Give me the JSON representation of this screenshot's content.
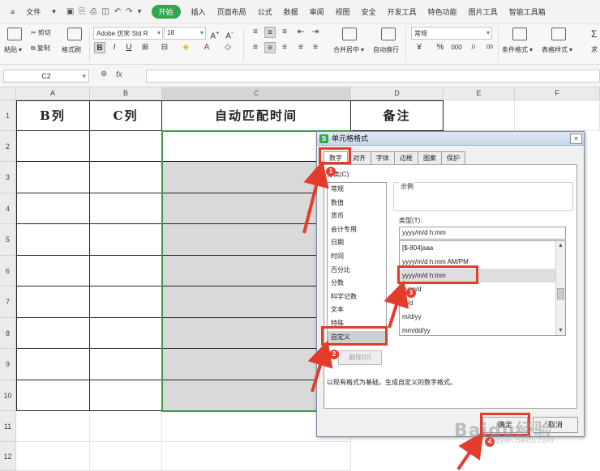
{
  "menubar": {
    "file_label": "文件",
    "tabs": [
      "开始",
      "插入",
      "页面布局",
      "公式",
      "数据",
      "审阅",
      "视图",
      "安全",
      "开发工具",
      "特色功能",
      "图片工具",
      "智能工具箱"
    ],
    "active_tab": "开始"
  },
  "ribbon": {
    "paste": "粘贴",
    "cut": "剪切",
    "copy": "复制",
    "format_painter": "格式刷",
    "font_name": "Adobe 仿宋 Std R",
    "font_size": "18",
    "merge_center": "合并居中",
    "wrap_text": "自动换行",
    "number_format": "常规",
    "conditional_format": "条件格式",
    "table_style": "表格样式",
    "sum": "求"
  },
  "formula_bar": {
    "name_box": "C2",
    "fx_label": "fx",
    "content": ""
  },
  "sheet": {
    "columns": [
      "A",
      "B",
      "C",
      "D",
      "E",
      "F"
    ],
    "selected_column": "C",
    "rows": [
      "1",
      "2",
      "3",
      "4",
      "5",
      "6",
      "7",
      "8",
      "9",
      "10",
      "11",
      "12"
    ],
    "headers": [
      "B列",
      "C列",
      "自动匹配时间",
      "备注"
    ]
  },
  "dialog": {
    "title": "单元格格式",
    "close_label": "×",
    "tabs": [
      "数字",
      "对齐",
      "字体",
      "边框",
      "图案",
      "保护"
    ],
    "active_tab": "数字",
    "category_label": "分类(C):",
    "categories": [
      "常规",
      "数值",
      "货币",
      "会计专用",
      "日期",
      "时间",
      "百分比",
      "分数",
      "科学记数",
      "文本",
      "特殊",
      "自定义"
    ],
    "selected_category": "自定义",
    "sample_label": "示例",
    "type_label": "类型(T):",
    "type_value": "yyyy/m/d h:mm",
    "type_list": [
      "[$-804]aaa",
      "yyyy/m/d h:mm AM/PM",
      "yyyy/m/d h:mm",
      "yy/m/d",
      "m/d",
      "m/d/yy",
      "mm/dd/yy"
    ],
    "selected_type": "yyyy/m/d h:mm",
    "delete_button": "删除(D)",
    "description": "以现有格式为基础，生成自定义的数字格式。",
    "ok_button": "确定",
    "cancel_button": "取消"
  },
  "annotations": {
    "badges": [
      "1",
      "2",
      "3",
      "4"
    ],
    "color": "#e53b2c"
  },
  "watermark": {
    "brand": "Baidu经验",
    "url": "jingyan.baidu.com"
  },
  "colors": {
    "accent_green": "#2fa84f",
    "selection_green": "#3c9a4a",
    "annotation_red": "#e53b2c"
  }
}
